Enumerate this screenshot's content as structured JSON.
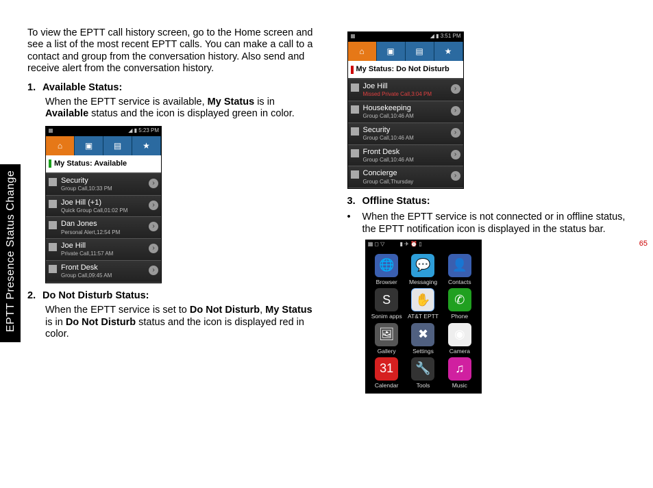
{
  "sidebar_title": "EPTT Presence Status Change",
  "page_number": "65",
  "col1": {
    "intro": "To view the EPTT call history screen, go to the Home screen and see a list of the most recent EPTT calls. You can make a call to a contact and group from the conversation history. Also send and receive alert from the conversation history.",
    "item1_num": "1.",
    "item1_head": "Available Status:",
    "item1_body_pre": "When the EPTT service is available, ",
    "item1_body_b1": "My Status",
    "item1_body_mid": " is in ",
    "item1_body_b2": "Available",
    "item1_body_post": " status and the icon is displayed green in color.",
    "item2_num": "2.",
    "item2_head": "Do Not Disturb Status:",
    "item2_body_pre": "When the EPTT service is set to ",
    "item2_body_b1": "Do Not Disturb",
    "item2_body_mid": ", ",
    "item2_body_b2": "My Status",
    "item2_body_mid2": " is in ",
    "item2_body_b3": "Do Not Disturb",
    "item2_body_post": " status and the icon is displayed red in color."
  },
  "col2": {
    "item3_num": "3.",
    "item3_head": "Offline Status:",
    "item3_bullet": "•",
    "item3_body": "When the EPTT service is not connected or in offline status, the EPTT notification icon is displayed in the status bar."
  },
  "phone_available": {
    "time": "5:23 PM",
    "status": "My Status: Available",
    "rows": [
      {
        "title": "Security",
        "sub": "Group Call,10:33 PM"
      },
      {
        "title": "Joe Hill (+1)",
        "sub": "Quick Group Call,01:02 PM"
      },
      {
        "title": "Dan Jones",
        "sub": "Personal Alert,12:54 PM"
      },
      {
        "title": "Joe Hill",
        "sub": "Private Call,11:57 AM"
      },
      {
        "title": "Front Desk",
        "sub": "Group Call,09:45 AM"
      }
    ]
  },
  "phone_dnd": {
    "time": "3:51 PM",
    "status": "My Status: Do Not Disturb",
    "rows": [
      {
        "title": "Joe Hill",
        "sub": "Missed Private Call,3:04 PM",
        "red": true
      },
      {
        "title": "Housekeeping",
        "sub": "Group Call,10:46 AM"
      },
      {
        "title": "Security",
        "sub": "Group Call,10:46 AM"
      },
      {
        "title": "Front Desk",
        "sub": "Group Call,10:46 AM"
      },
      {
        "title": "Concierge",
        "sub": "Group Call,Thursday"
      }
    ]
  },
  "home_apps": [
    {
      "label": "Browser",
      "cls": "ic-browser",
      "glyph": "🌐"
    },
    {
      "label": "Messaging",
      "cls": "ic-msg",
      "glyph": "💬"
    },
    {
      "label": "Contacts",
      "cls": "ic-contacts",
      "glyph": "👤"
    },
    {
      "label": "Sonim apps",
      "cls": "ic-sonim",
      "glyph": "S"
    },
    {
      "label": "AT&T EPTT",
      "cls": "ic-eptt",
      "glyph": "✋"
    },
    {
      "label": "Phone",
      "cls": "ic-phone",
      "glyph": "✆"
    },
    {
      "label": "Gallery",
      "cls": "ic-gallery",
      "glyph": "🖼"
    },
    {
      "label": "Settings",
      "cls": "ic-settings",
      "glyph": "✖"
    },
    {
      "label": "Camera",
      "cls": "ic-camera",
      "glyph": "◉"
    },
    {
      "label": "Calendar",
      "cls": "ic-cal",
      "glyph": "31"
    },
    {
      "label": "Tools",
      "cls": "ic-tools",
      "glyph": "🔧"
    },
    {
      "label": "Music",
      "cls": "ic-music",
      "glyph": "♫"
    }
  ]
}
